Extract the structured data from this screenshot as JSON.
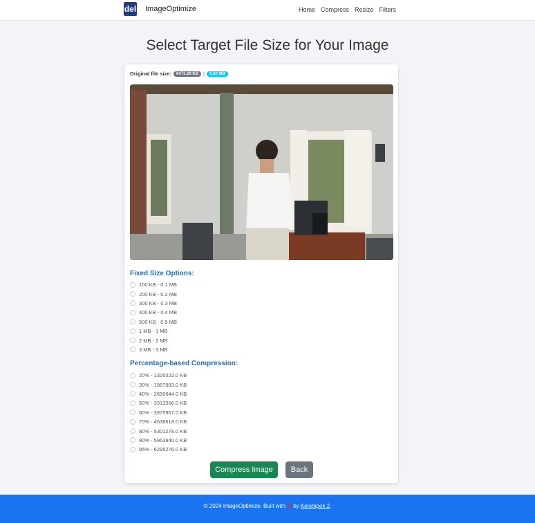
{
  "navbar": {
    "logo_text": "del",
    "brand": "ImageOptimize",
    "links": [
      "Home",
      "Compress",
      "Resize",
      "Filters"
    ]
  },
  "page_title": "Select Target File Size for Your Image",
  "file_info": {
    "label": "Original file size:",
    "size_kb": "6471.28 KB",
    "separator": "|",
    "size_mb": "6.32 MB"
  },
  "fixed_section": {
    "title": "Fixed Size Options:",
    "options": [
      "100 KB - 0.1 MB",
      "200 KB - 0.2 MB",
      "300 KB - 0.3 MB",
      "400 KB - 0.4 MB",
      "500 KB - 0.5 MB",
      "1 MB - 1 MB",
      "2 MB - 2 MB",
      "3 MB - 3 MB"
    ]
  },
  "percent_section": {
    "title": "Percentage-based Compression:",
    "options": [
      "20% - 1325322.0 KB",
      "30% - 1987983.0 KB",
      "40% - 2650644.0 KB",
      "50% - 3313306.0 KB",
      "60% - 3975967.0 KB",
      "70% - 4638618.0 KB",
      "80% - 5301278.0 KB",
      "90% - 5963940.0 KB",
      "95% - 6295276.0 KB"
    ]
  },
  "buttons": {
    "compress": "Compress Image",
    "back": "Back"
  },
  "footer": {
    "prefix": "© 2024 ImageOptimize. Built with",
    "heart": "❤",
    "by": "by",
    "team": "Kelompok 2",
    "suffix": "."
  }
}
